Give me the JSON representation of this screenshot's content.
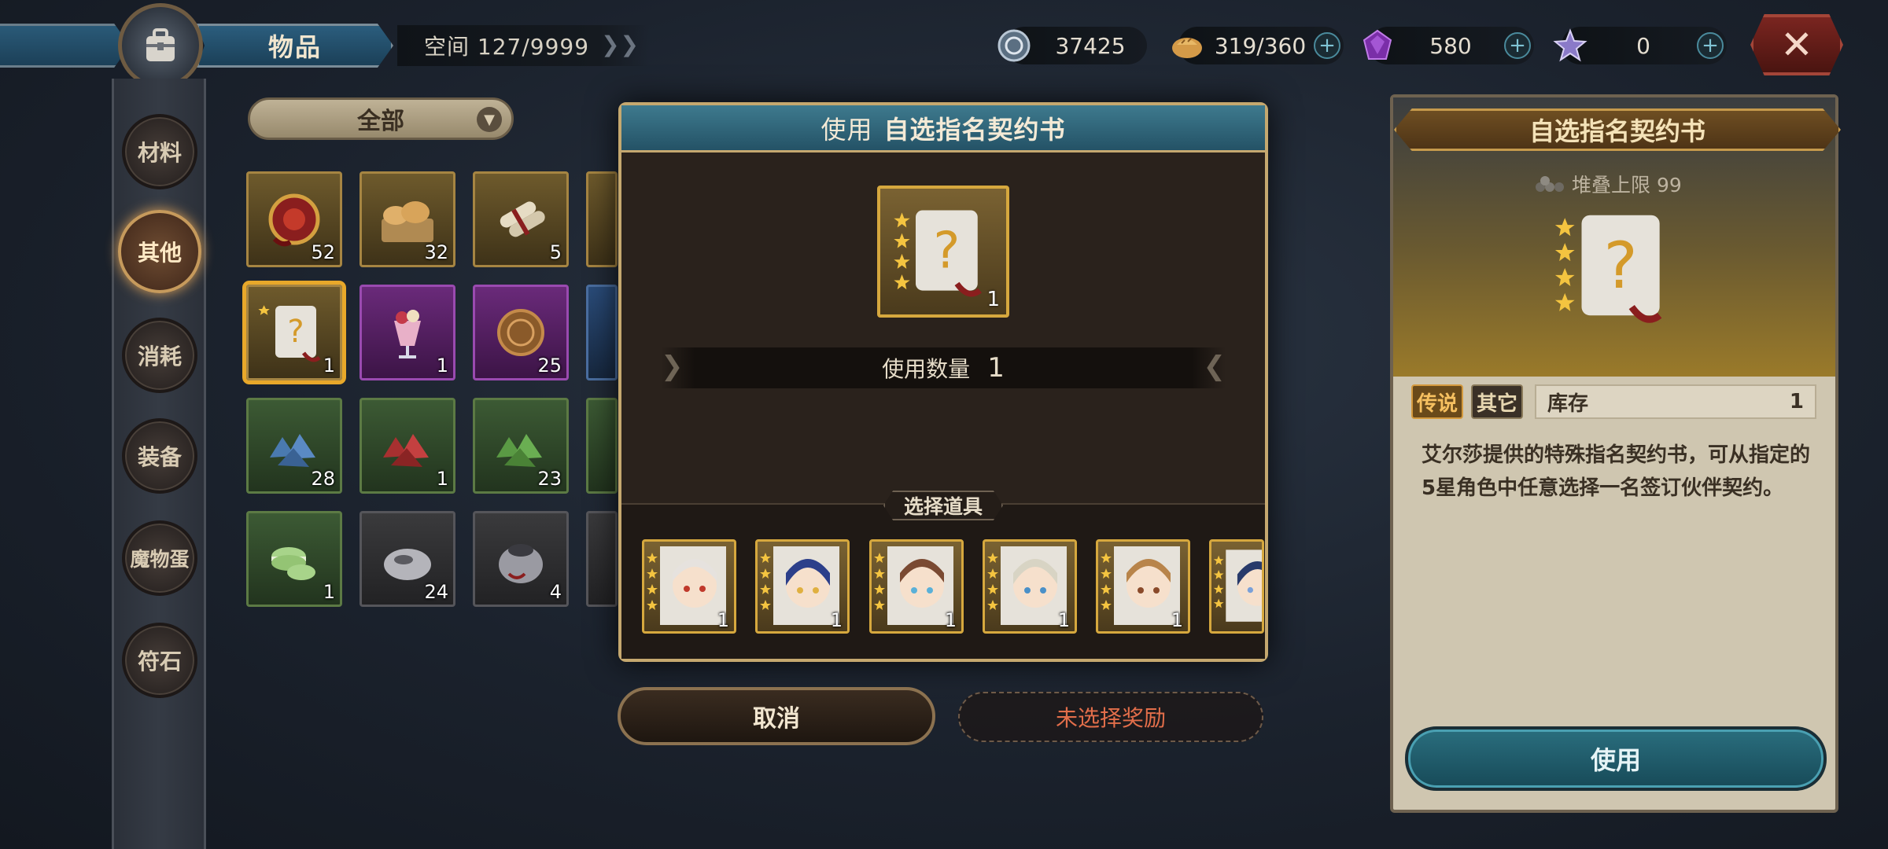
{
  "topbar": {
    "title": "物品",
    "space": "空间 127/9999",
    "currencies": [
      {
        "icon": "silver-coin-icon",
        "value": "37425"
      },
      {
        "icon": "bread-stamina-icon",
        "value": "319/360"
      },
      {
        "icon": "purple-gem-icon",
        "value": "580"
      },
      {
        "icon": "star-crystal-icon",
        "value": "0"
      }
    ],
    "close_label": "✕"
  },
  "sidebar": {
    "items": [
      {
        "label": "材料",
        "active": false
      },
      {
        "label": "其他",
        "active": true
      },
      {
        "label": "消耗",
        "active": false
      },
      {
        "label": "装备",
        "active": false
      },
      {
        "label": "魔物蛋",
        "active": false
      },
      {
        "label": "符石",
        "active": false
      }
    ]
  },
  "filter": {
    "label": "全部"
  },
  "grid": {
    "rows": [
      [
        {
          "icon": "red-amulet-icon",
          "count": "52",
          "rarity": "gold"
        },
        {
          "icon": "bread-basket-icon",
          "count": "32",
          "rarity": "gold"
        },
        {
          "icon": "scroll-bundle-icon",
          "count": "5",
          "rarity": "gold"
        }
      ],
      [
        {
          "icon": "contract-scroll-icon",
          "count": "1",
          "rarity": "gold",
          "selected": true
        },
        {
          "icon": "parfait-icon",
          "count": "1",
          "rarity": "purple"
        },
        {
          "icon": "bronze-medal-icon",
          "count": "25",
          "rarity": "purple"
        }
      ],
      [
        {
          "icon": "blue-ore-icon",
          "count": "28",
          "rarity": "green"
        },
        {
          "icon": "red-ore-icon",
          "count": "1",
          "rarity": "green"
        },
        {
          "icon": "green-ore-icon",
          "count": "23",
          "rarity": "green"
        }
      ],
      [
        {
          "icon": "macaron-icon",
          "count": "1",
          "rarity": "green"
        },
        {
          "icon": "grey-sack-icon",
          "count": "24",
          "rarity": "grey"
        },
        {
          "icon": "ore-sack-icon",
          "count": "4",
          "rarity": "grey"
        }
      ]
    ]
  },
  "dialog": {
    "title_prefix": "使用",
    "title_item": "自选指名契约书",
    "item_count": "1",
    "qty_label": "使用数量",
    "qty_value": "1",
    "select_label": "选择道具",
    "rewards": [
      {
        "count": "1",
        "hair": "#e6e2de",
        "eye": "#c0392b"
      },
      {
        "count": "1",
        "hair": "#2c3f8a",
        "eye": "#e0b040"
      },
      {
        "count": "1",
        "hair": "#7a4a32",
        "eye": "#5ab0d8"
      },
      {
        "count": "1",
        "hair": "#d8d4c4",
        "eye": "#4a90c8"
      },
      {
        "count": "1",
        "hair": "#b8844a",
        "eye": "#8a4a2a"
      },
      {
        "count": "",
        "hair": "#283a6a",
        "eye": "#7aa0d8"
      }
    ],
    "cancel_label": "取消",
    "no_reward_label": "未选择奖励"
  },
  "detail": {
    "title": "自选指名契约书",
    "stack_limit": "堆叠上限 99",
    "tag_rarity": "传说",
    "tag_type": "其它",
    "stock_label": "库存",
    "stock_value": "1",
    "description": "艾尔莎提供的特殊指名契约书，可从指定的5星角色中任意选择一名签订伙伴契约。",
    "use_label": "使用"
  },
  "colors": {
    "accent_gold": "#c5a86f",
    "title_teal": "#245266",
    "warning_text": "#e26e4a",
    "legend_tag": "#f6c060"
  }
}
